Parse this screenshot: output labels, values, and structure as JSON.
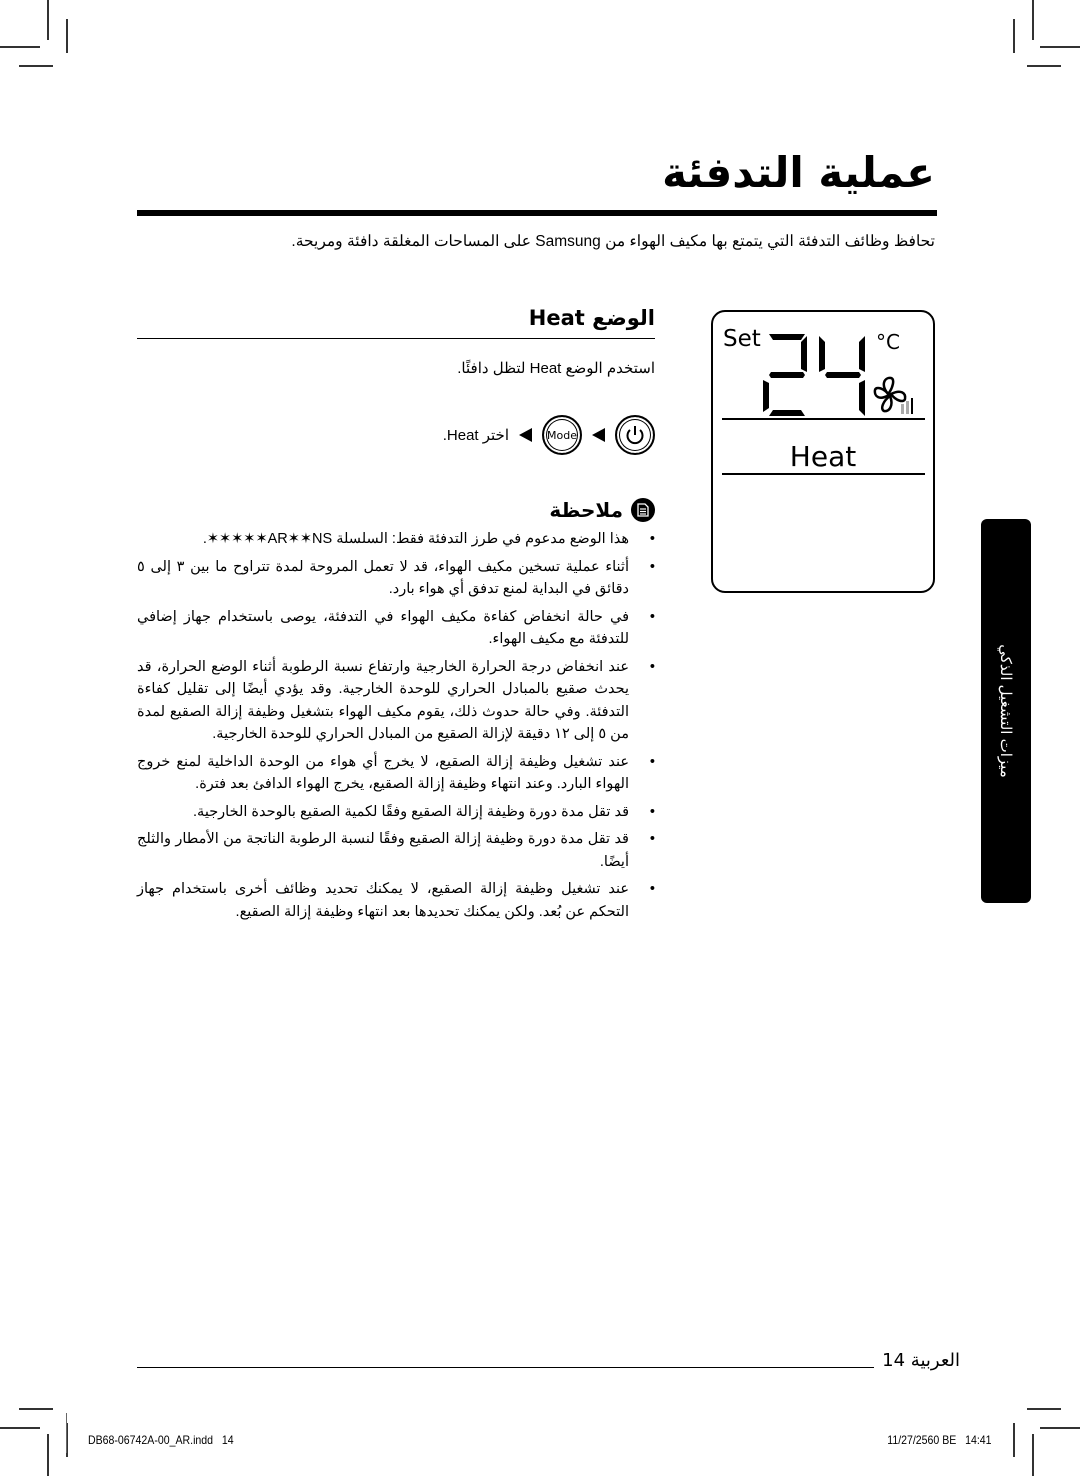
{
  "page": {
    "title": "عملية التدفئة",
    "intro": "تحافظ وظائف التدفئة التي يتمتع بها مكيف الهواء من Samsung على المساحات المغلقة دافئة ومريحة."
  },
  "lcd": {
    "set_label": "Set",
    "temperature": "24",
    "unit": "°C",
    "mode": "Heat",
    "fan_icon": "fan-icon",
    "fan_level_bars": 3,
    "fan_level_active": 1
  },
  "section": {
    "heading": "الوضع Heat",
    "description": "استخدم الوضع Heat لتظل دافئًا.",
    "steps": {
      "power_icon": "power-icon",
      "mode_button_label": "Mode",
      "final_text": "اختر Heat."
    }
  },
  "note": {
    "icon": "note-document-icon",
    "title": "ملاحظة",
    "bullet": "•",
    "items": [
      "هذا الوضع مدعوم في طرز التدفئة فقط: السلسلة AR✶✶NS✶✶✶✶✶.",
      "أثناء عملية تسخين مكيف الهواء، قد لا تعمل المروحة لمدة تتراوح ما بين ٣ إلى ٥ دقائق في البداية لمنع تدفق أي هواء بارد.",
      "في حالة انخفاض كفاءة مكيف الهواء في التدفئة، يوصى باستخدام جهاز إضافي للتدفئة مع مكيف الهواء.",
      "عند انخفاض درجة الحرارة الخارجية وارتفاع نسبة الرطوبة أثناء الوضع الحرارة، قد يحدث صقيع بالمبادل الحراري للوحدة الخارجية. وقد يؤدي أيضًا إلى تقليل كفاءة التدفئة. وفي حالة حدوث ذلك، يقوم مكيف الهواء بتشغيل وظيفة إزالة الصقيع لمدة من ٥ إلى ١٢ دقيقة لإزالة الصقيع من المبادل الحراري للوحدة الخارجية.",
      "عند تشغيل وظيفة إزالة الصقيع، لا يخرج أي هواء من الوحدة الداخلية لمنع خروج الهواء البارد. وعند انتهاء وظيفة إزالة الصقيع، يخرج الهواء الدافئ بعد فترة.",
      "قد تقل مدة دورة وظيفة إزالة الصقيع وفقًا لكمية الصقيع بالوحدة الخارجية.",
      "قد تقل مدة دورة وظيفة إزالة الصقيع وفقًا لنسبة الرطوبة الناتجة من الأمطار والثلج أيضًا.",
      "عند تشغيل وظيفة إزالة الصقيع، لا يمكنك تحديد وظائف أخرى باستخدام جهاز التحكم عن بُعد. ولكن يمكنك تحديدها بعد انتهاء وظيفة إزالة الصقيع."
    ]
  },
  "side_tab": {
    "label": "ميزات التشغيل الذكي"
  },
  "footer": {
    "page_number": "14",
    "language": "العربية",
    "slug_file": "DB68-06742A-00_AR.indd   14",
    "slug_date": "11/27/2560 BE   14:41"
  }
}
